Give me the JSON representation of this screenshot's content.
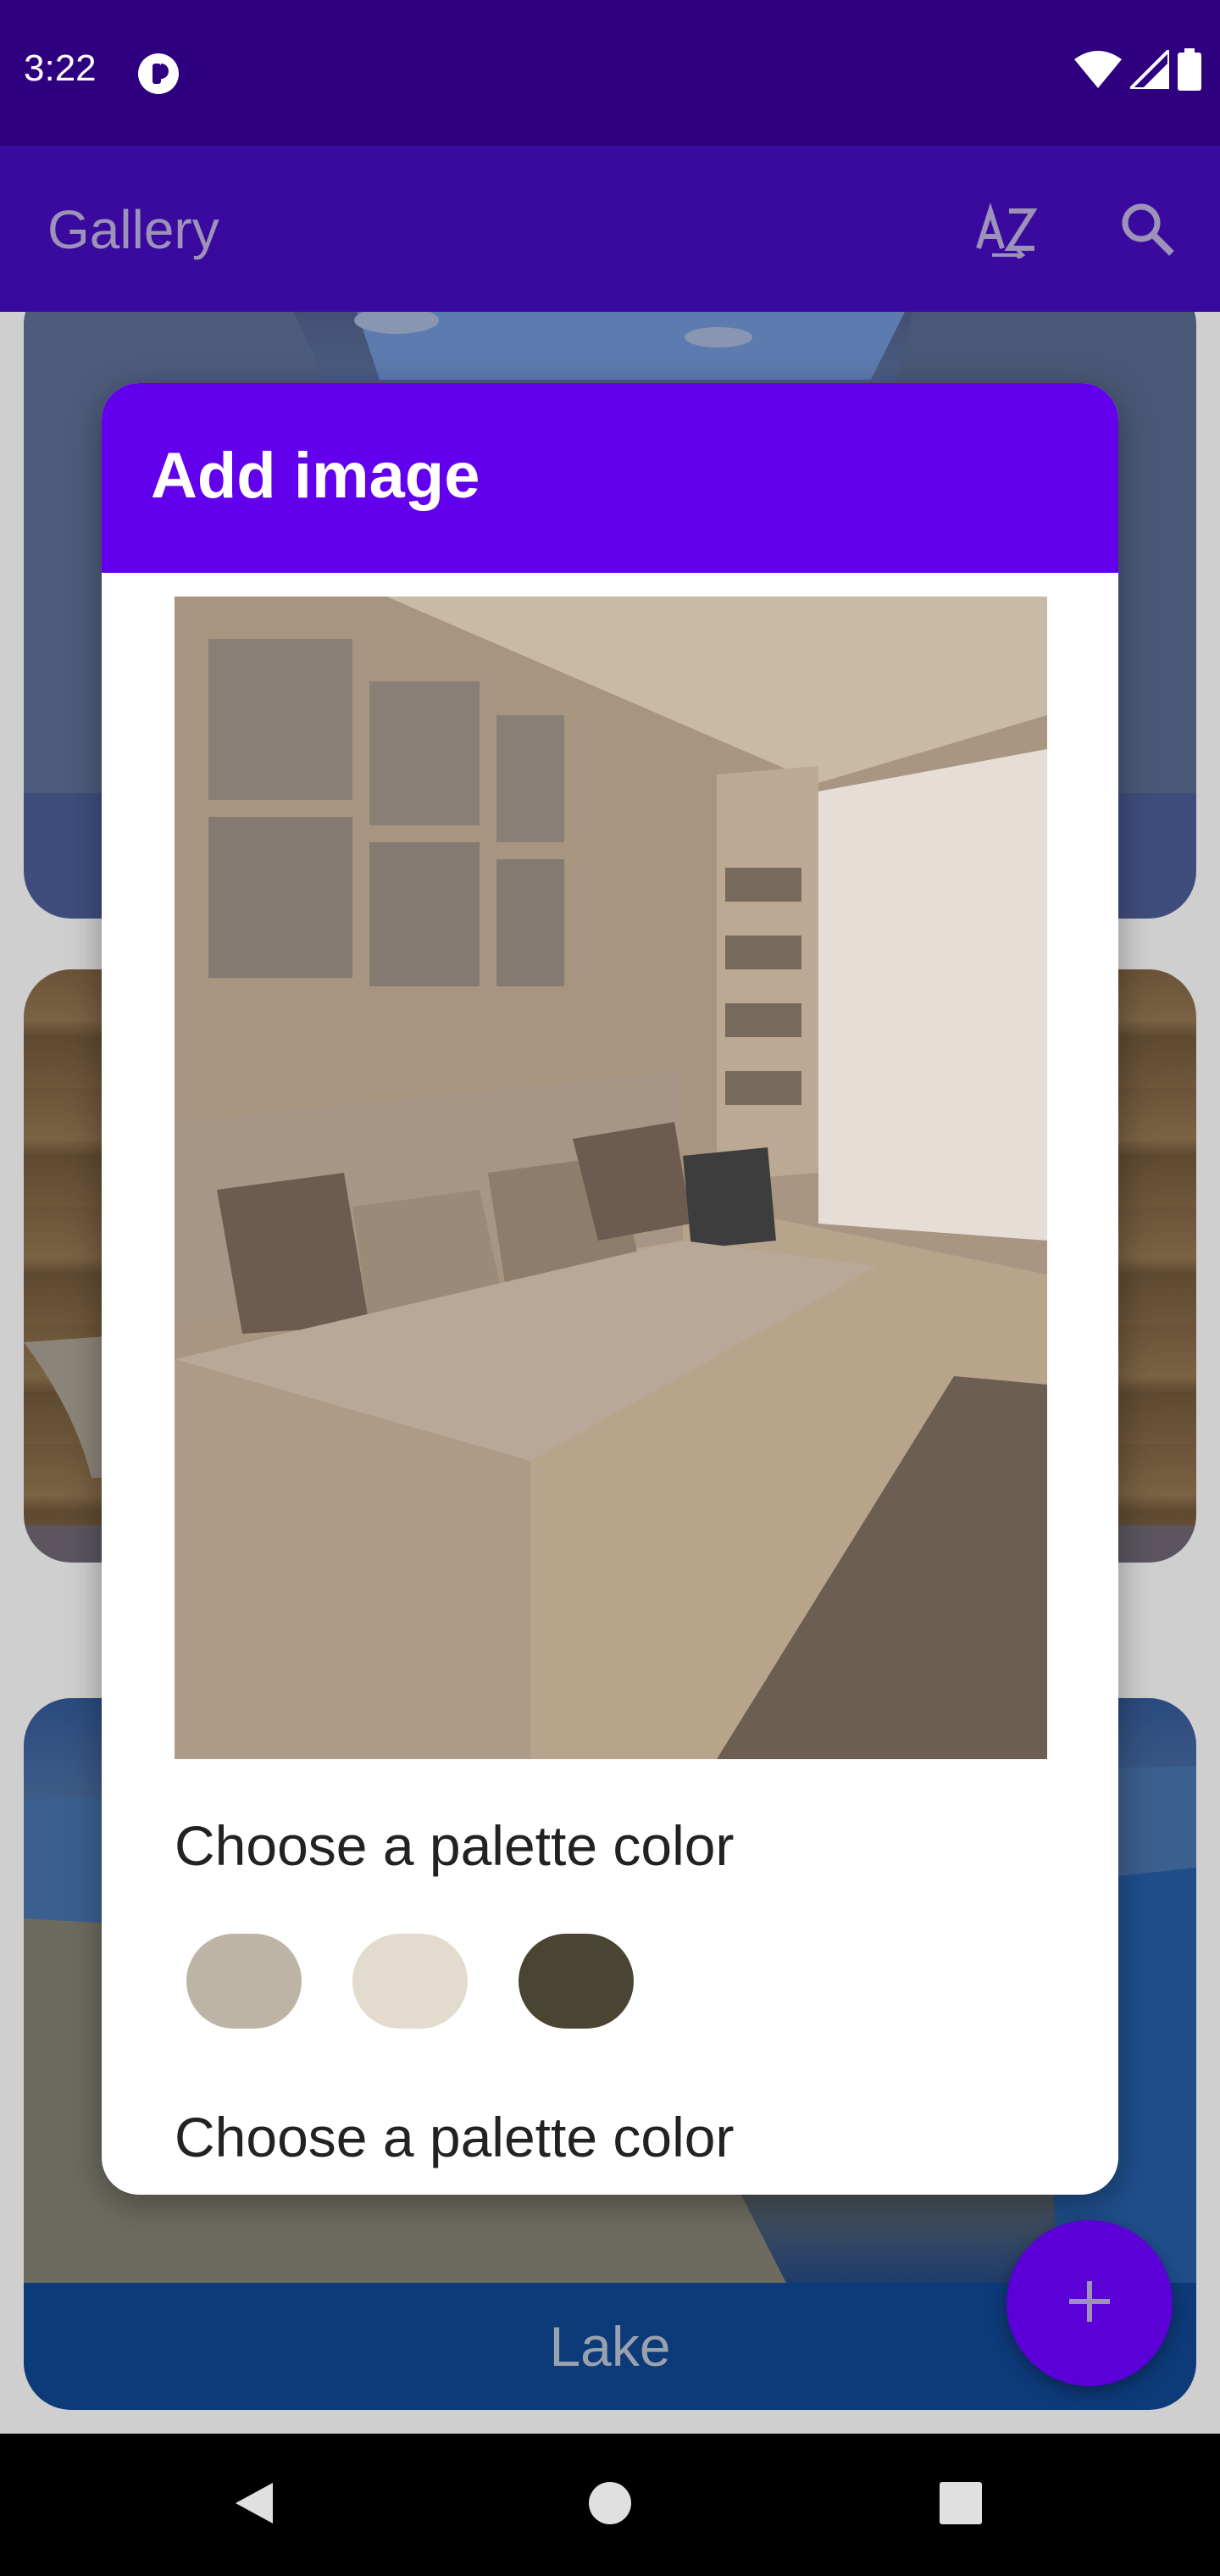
{
  "status_bar": {
    "time": "3:22",
    "icons": [
      "app-notification-icon",
      "wifi-icon",
      "signal-icon",
      "battery-icon"
    ]
  },
  "app_bar": {
    "title": "Gallery",
    "actions": [
      "sort-az-icon",
      "search-icon"
    ]
  },
  "gallery": {
    "cards": [
      {
        "label": ""
      },
      {
        "label": ""
      },
      {
        "label": "Lake"
      }
    ]
  },
  "dialog": {
    "title": "Add image",
    "palette_heading_1": "Choose a palette color",
    "palette_heading_2": "Choose a palette color",
    "swatches": [
      "#bdb4a5",
      "#e3dbcd",
      "#4a4432"
    ]
  },
  "fab": {
    "icon": "plus-icon"
  },
  "nav_bar": {
    "buttons": [
      "back-icon",
      "home-icon",
      "recents-icon"
    ]
  },
  "colors": {
    "status_bar": "#2e0080",
    "app_bar": "#3a0a9e",
    "dialog_header": "#6200ee",
    "fab": "#5b00d6"
  }
}
